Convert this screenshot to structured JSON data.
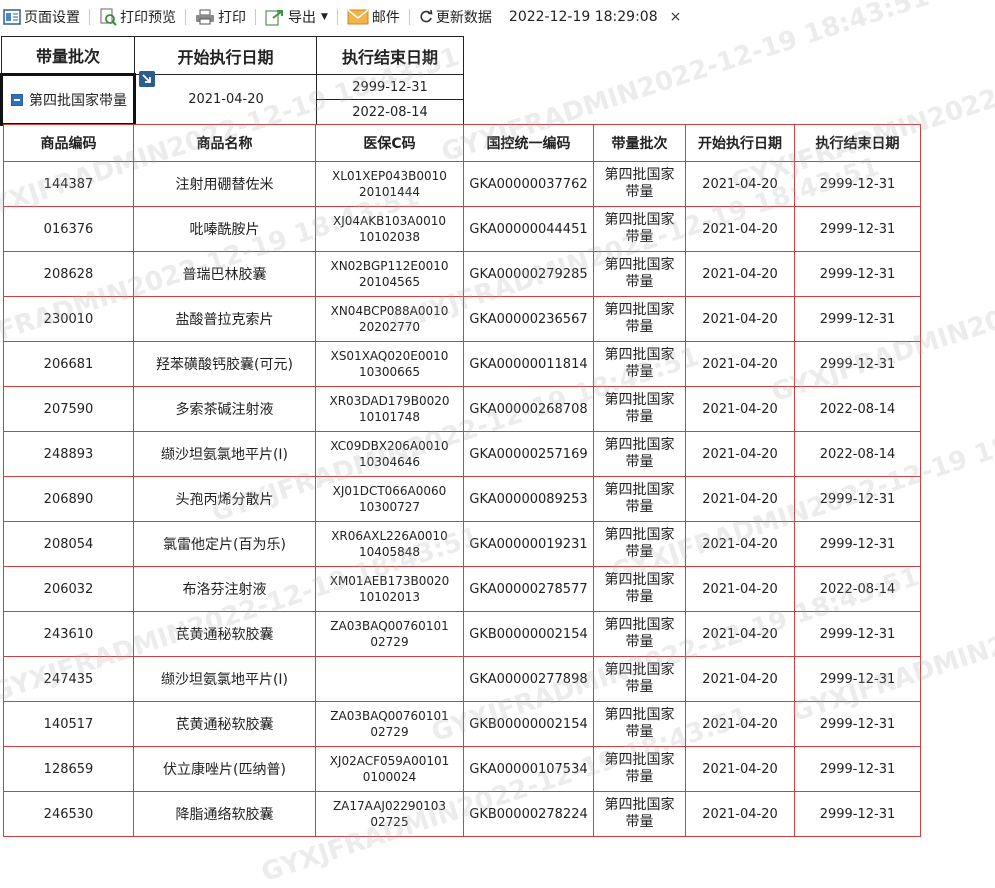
{
  "toolbar": {
    "page_setup": "页面设置",
    "print_preview": "打印预览",
    "print": "打印",
    "export": "导出",
    "mail": "邮件",
    "refresh": "更新数据",
    "timestamp": "2022-12-19 18:29:08",
    "close": "×"
  },
  "filter": {
    "headers": [
      "带量批次",
      "开始执行日期",
      "执行结束日期"
    ],
    "batch_value": "第四批国家带量",
    "start_date": "2021-04-20",
    "end_dates": [
      "2999-12-31",
      "2022-08-14"
    ]
  },
  "table": {
    "headers": [
      "商品编码",
      "商品名称",
      "医保C码",
      "国控统一编码",
      "带量批次",
      "开始执行日期",
      "执行结束日期"
    ],
    "rows": [
      [
        "144387",
        "注射用硼替佐米",
        "XL01XEP043B001020101444",
        "GKA00000037762",
        "第四批国家带量",
        "2021-04-20",
        "2999-12-31"
      ],
      [
        "016376",
        "吡嗪酰胺片",
        "XJ04AKB103A001010102038",
        "GKA00000044451",
        "第四批国家带量",
        "2021-04-20",
        "2999-12-31"
      ],
      [
        "208628",
        "普瑞巴林胶囊",
        "XN02BGP112E001020104565",
        "GKA00000279285",
        "第四批国家带量",
        "2021-04-20",
        "2999-12-31"
      ],
      [
        "230010",
        "盐酸普拉克索片",
        "XN04BCP088A001020202770",
        "GKA00000236567",
        "第四批国家带量",
        "2021-04-20",
        "2999-12-31"
      ],
      [
        "206681",
        "羟苯磺酸钙胶囊(可元)",
        "XS01XAQ020E001010300665",
        "GKA00000011814",
        "第四批国家带量",
        "2021-04-20",
        "2999-12-31"
      ],
      [
        "207590",
        "多索茶碱注射液",
        "XR03DAD179B002010101748",
        "GKA00000268708",
        "第四批国家带量",
        "2021-04-20",
        "2022-08-14"
      ],
      [
        "248893",
        "缬沙坦氨氯地平片(Ⅰ)",
        "XC09DBX206A001010304646",
        "GKA00000257169",
        "第四批国家带量",
        "2021-04-20",
        "2022-08-14"
      ],
      [
        "206890",
        "头孢丙烯分散片",
        "XJ01DCT066A006010300727",
        "GKA00000089253",
        "第四批国家带量",
        "2021-04-20",
        "2999-12-31"
      ],
      [
        "208054",
        "氯雷他定片(百为乐)",
        "XR06AXL226A001010405848",
        "GKA00000019231",
        "第四批国家带量",
        "2021-04-20",
        "2999-12-31"
      ],
      [
        "206032",
        "布洛芬注射液",
        "XM01AEB173B002010102013",
        "GKA00000278577",
        "第四批国家带量",
        "2021-04-20",
        "2022-08-14"
      ],
      [
        "243610",
        "芪黄通秘软胶囊",
        "ZA03BAQ0076010102729",
        "GKB00000002154",
        "第四批国家带量",
        "2021-04-20",
        "2999-12-31"
      ],
      [
        "247435",
        "缬沙坦氨氯地平片(Ⅰ)",
        "",
        "GKA00000277898",
        "第四批国家带量",
        "2021-04-20",
        "2999-12-31"
      ],
      [
        "140517",
        "芪黄通秘软胶囊",
        "ZA03BAQ0076010102729",
        "GKB00000002154",
        "第四批国家带量",
        "2021-04-20",
        "2999-12-31"
      ],
      [
        "128659",
        "伏立康唑片(匹纳普)",
        "XJ02ACF059A001010100024",
        "GKA00000107534",
        "第四批国家带量",
        "2021-04-20",
        "2999-12-31"
      ],
      [
        "246530",
        "降脂通络软胶囊",
        "ZA17AAJ0229010302725",
        "GKB00000278224",
        "第四批国家带量",
        "2021-04-20",
        "2999-12-31"
      ]
    ]
  },
  "watermark": "GYXJFRADMIN2022-12-19 18:43:51"
}
